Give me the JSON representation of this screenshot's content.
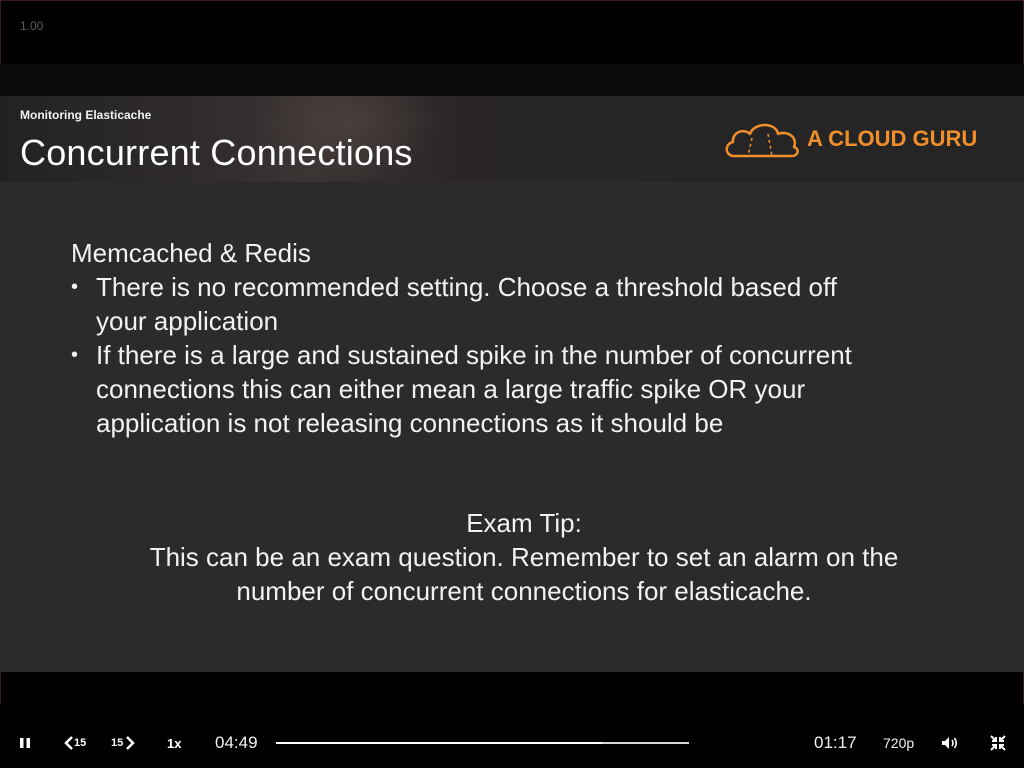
{
  "overlay": {
    "speed_readout": "1.00"
  },
  "slide": {
    "section": "Monitoring Elasticache",
    "title": "Concurrent Connections",
    "logo_text": "A CLOUD GURU",
    "brand_color": "#f08e2c",
    "heading": "Memcached & Redis",
    "bullets": [
      {
        "line1": "There is no recommended setting. Choose a threshold based off",
        "line2": "your application",
        "line3": ""
      },
      {
        "line1": "If there is a large and sustained spike in the number of concurrent",
        "line2": "connections this can either mean a large traffic spike OR your",
        "line3": "application is not releasing connections as it should be"
      }
    ],
    "tip_title": "Exam Tip:",
    "tip_line1": "This can be an exam question. Remember to set an alarm on the",
    "tip_line2": "number of concurrent connections for elasticache."
  },
  "player": {
    "icons": {
      "play_pause": "pause-icon",
      "rewind": "rewind-15-icon",
      "forward": "forward-15-icon",
      "volume": "volume-icon",
      "fullscreen": "exit-fullscreen-icon"
    },
    "rewind_label": "15",
    "forward_label": "15",
    "speed_label": "1x",
    "elapsed": "04:49",
    "remaining": "01:17",
    "quality": "720p",
    "progress_fraction": 0.79
  }
}
